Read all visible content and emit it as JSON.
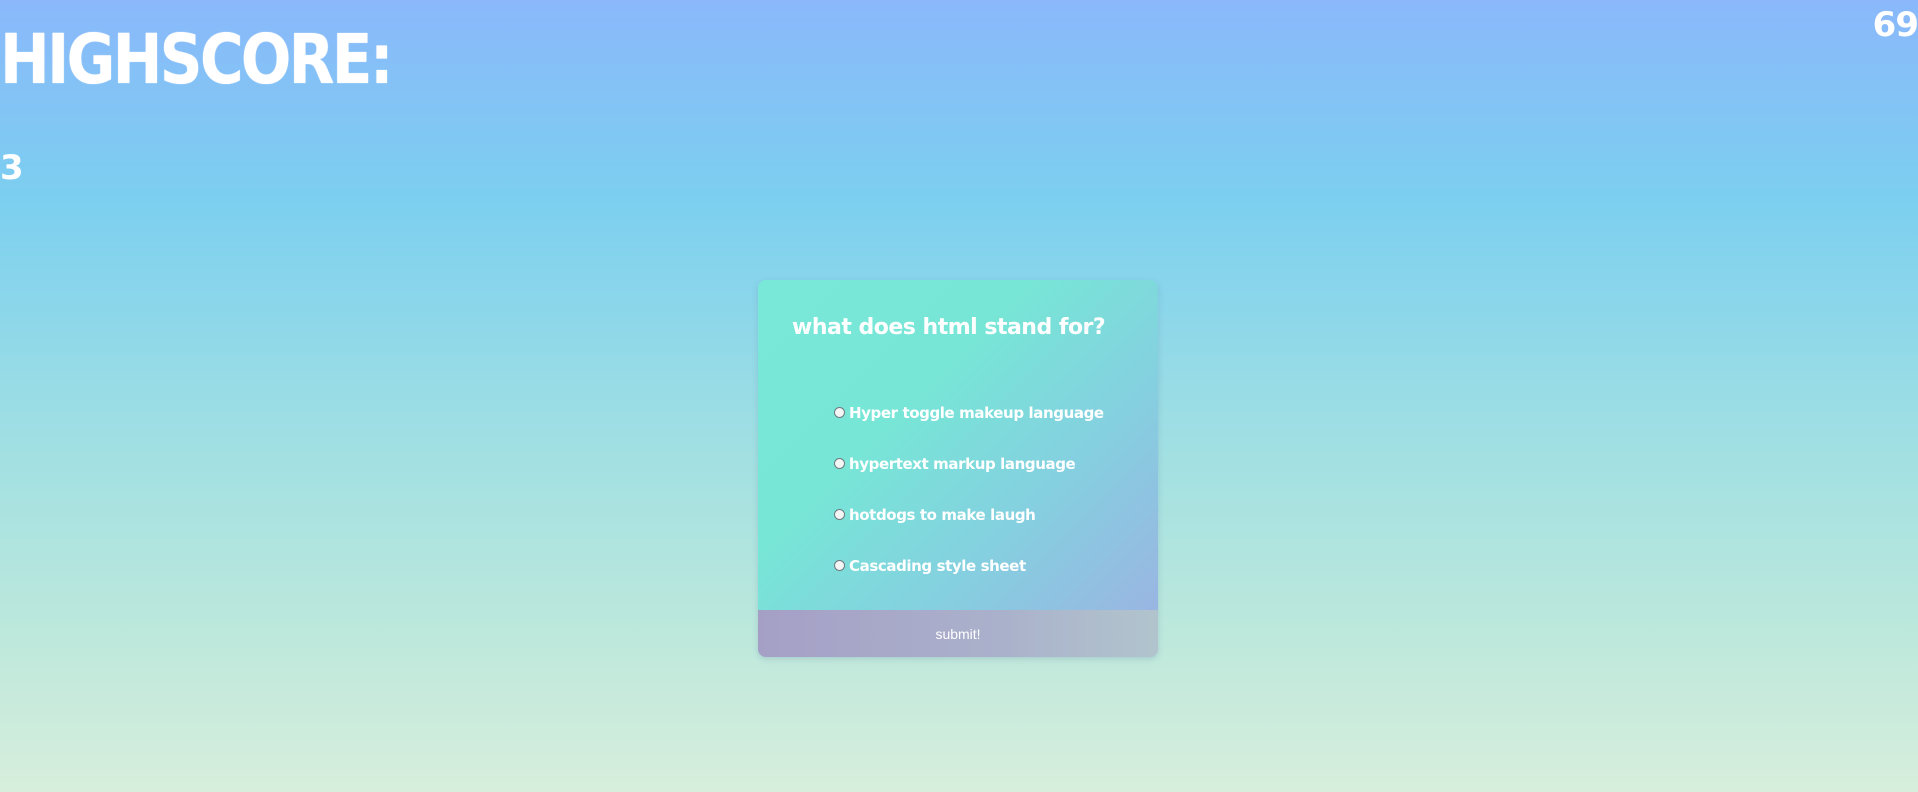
{
  "highscore": {
    "title": "HIGHSCORE:",
    "value": "3"
  },
  "timer": {
    "value": "69"
  },
  "quiz": {
    "question": "what does html stand for?",
    "options": [
      {
        "label": "Hyper toggle makeup language"
      },
      {
        "label": "hypertext markup language"
      },
      {
        "label": "hotdogs to make laugh"
      },
      {
        "label": "Cascading style sheet"
      }
    ],
    "submit_label": "submit!"
  },
  "colors": {
    "background_top": "#8ab8fb",
    "background_bottom": "#d7eedc",
    "card_start": "#7ae8d8",
    "card_end": "#9eb0e2",
    "submit_bar": "#a59fc6",
    "text": "#ffffff"
  }
}
